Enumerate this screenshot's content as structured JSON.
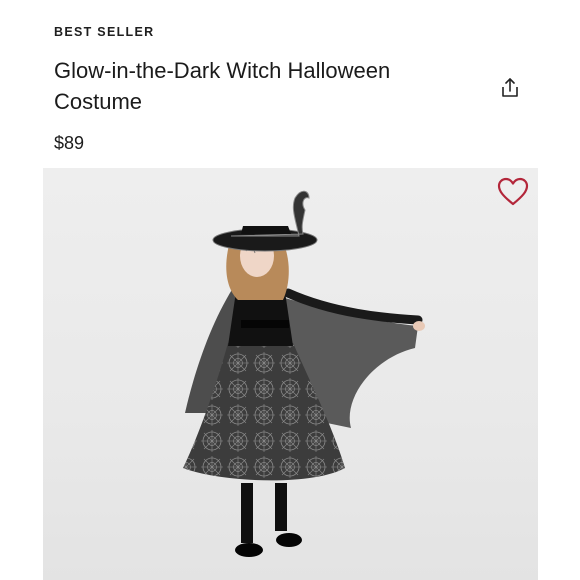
{
  "product": {
    "badge": "BEST SELLER",
    "title": "Glow-in-the-Dark Witch Halloween Costume",
    "price": "$89"
  },
  "icons": {
    "share": "share-icon",
    "favorite": "heart-outline-icon"
  },
  "colors": {
    "heart_accent": "#b3263a",
    "text": "#1b1b1b"
  }
}
